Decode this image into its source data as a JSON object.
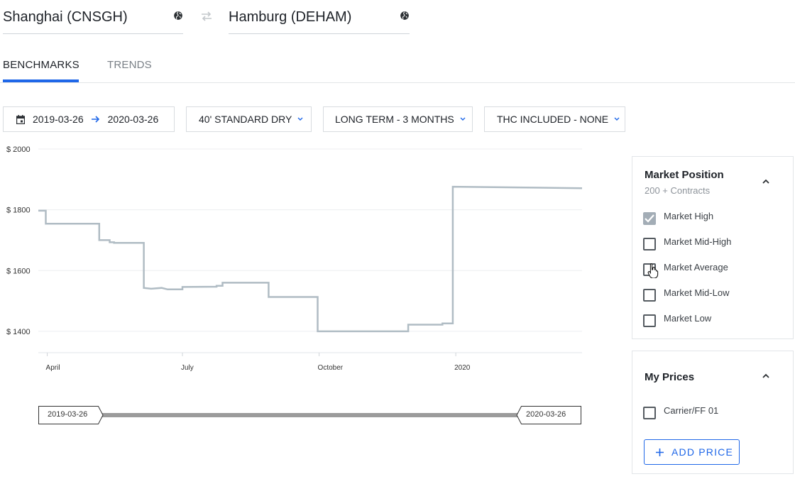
{
  "route": {
    "origin": "Shanghai (CNSGH)",
    "destination": "Hamburg (DEHAM)",
    "origin_icon": "globe-icon",
    "destination_icon": "globe-icon",
    "swap_icon": "swap-arrows-icon"
  },
  "tabs": [
    {
      "label": "BENCHMARKS",
      "active": true
    },
    {
      "label": "TRENDS",
      "active": false
    }
  ],
  "filters": {
    "date_start": "2019-03-26",
    "date_end": "2020-03-26",
    "container": "40' STANDARD DRY",
    "term": "LONG TERM - 3 MONTHS",
    "thc": "THC INCLUDED - NONE"
  },
  "chart_data": {
    "type": "line",
    "xlabel": "",
    "ylabel": "",
    "x_tick_labels": [
      "April",
      "July",
      "October",
      "2020"
    ],
    "y_tick_labels": [
      "$ 2000",
      "$ 1800",
      "$ 1600",
      "$ 1400"
    ],
    "y_ticks": [
      2000,
      1800,
      1600,
      1400
    ],
    "ylim": [
      1325,
      2000
    ],
    "xlim": [
      "2019-03-26",
      "2020-03-26"
    ],
    "grid": true,
    "step": true,
    "line_color": "#b0bcc4",
    "series": [
      {
        "x": [
          "2019-03-26",
          "2019-03-31",
          "2019-03-31",
          "2019-05-06",
          "2019-05-06",
          "2019-05-13",
          "2019-05-13",
          "2019-05-16",
          "2019-05-16",
          "2019-06-05",
          "2019-06-05",
          "2019-06-10",
          "2019-06-17",
          "2019-06-21",
          "2019-07-01",
          "2019-07-01",
          "2019-07-24",
          "2019-07-24",
          "2019-07-28",
          "2019-07-28",
          "2019-08-28",
          "2019-08-28",
          "2019-09-30",
          "2019-09-30",
          "2019-11-30",
          "2019-11-30",
          "2019-12-23",
          "2019-12-23",
          "2019-12-30",
          "2019-12-30",
          "2020-02-01",
          "2020-03-26"
        ],
        "y": [
          1797,
          1797,
          1754,
          1754,
          1700,
          1700,
          1693,
          1693,
          1691,
          1691,
          1543,
          1540,
          1543,
          1538,
          1538,
          1546,
          1547,
          1550,
          1550,
          1560,
          1560,
          1513,
          1513,
          1400,
          1400,
          1422,
          1422,
          1426,
          1426,
          1876,
          1874,
          1871
        ]
      }
    ]
  },
  "slider": {
    "start_label": "2019-03-26",
    "end_label": "2020-03-26"
  },
  "market_position": {
    "title": "Market Position",
    "subtitle": "200 + Contracts",
    "collapse_icon": "chevron-up-icon",
    "options": [
      {
        "label": "Market High",
        "checked": true
      },
      {
        "label": "Market Mid-High",
        "checked": false
      },
      {
        "label": "Market Average",
        "checked": false
      },
      {
        "label": "Market Mid-Low",
        "checked": false
      },
      {
        "label": "Market Low",
        "checked": false
      }
    ]
  },
  "my_prices": {
    "title": "My Prices",
    "collapse_icon": "chevron-up-icon",
    "options": [
      {
        "label": "Carrier/FF 01",
        "checked": false
      }
    ],
    "add_button": "ADD PRICE"
  },
  "colors": {
    "accent": "#1f67e8",
    "series_line": "#b0bcc4",
    "checked_box": "#a3adb6"
  }
}
